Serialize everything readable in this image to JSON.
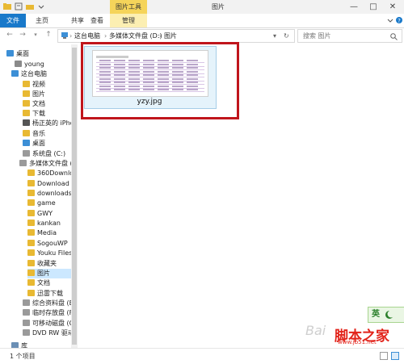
{
  "window": {
    "title": "图片",
    "tools_tab": "图片工具",
    "controls": [
      "—",
      "□",
      "✕"
    ]
  },
  "ribbon": {
    "tabs": [
      "文件",
      "主页",
      "共享",
      "查看",
      "管理"
    ]
  },
  "address": {
    "back": "←",
    "forward": "→",
    "up": "↑",
    "path": [
      "这台电脑",
      "多媒体文件盘 (D:)",
      "图片"
    ],
    "separator": "›",
    "dropdown": "▾",
    "refresh": "↻",
    "search_placeholder": "搜索 图片"
  },
  "nav": {
    "items": [
      {
        "label": "桌面",
        "icon": "desktop-icon"
      },
      {
        "label": "young",
        "icon": "user-icon"
      },
      {
        "label": "这台电脑",
        "icon": "computer-icon"
      },
      {
        "label": "视频",
        "icon": "video-folder-icon"
      },
      {
        "label": "图片",
        "icon": "pictures-folder-icon"
      },
      {
        "label": "文档",
        "icon": "documents-folder-icon"
      },
      {
        "label": "下载",
        "icon": "downloads-folder-icon"
      },
      {
        "label": "杨正英的 iPho",
        "icon": "phone-icon"
      },
      {
        "label": "音乐",
        "icon": "music-folder-icon"
      },
      {
        "label": "桌面",
        "icon": "desktop-icon"
      },
      {
        "label": "系统盘 (C:)",
        "icon": "drive-icon"
      },
      {
        "label": "多媒体文件盘 (D:",
        "icon": "drive-icon"
      },
      {
        "label": "360Downlo",
        "icon": "folder-icon"
      },
      {
        "label": "Download",
        "icon": "folder-icon"
      },
      {
        "label": "downloads",
        "icon": "folder-icon"
      },
      {
        "label": "game",
        "icon": "folder-icon"
      },
      {
        "label": "GWY",
        "icon": "folder-icon"
      },
      {
        "label": "kankan",
        "icon": "folder-icon"
      },
      {
        "label": "Media",
        "icon": "folder-icon"
      },
      {
        "label": "SogouWP",
        "icon": "folder-icon"
      },
      {
        "label": "Youku Files",
        "icon": "folder-icon"
      },
      {
        "label": "收藏夹",
        "icon": "folder-icon"
      },
      {
        "label": "图片",
        "icon": "folder-icon"
      },
      {
        "label": "文档",
        "icon": "folder-icon"
      },
      {
        "label": "迅雷下载",
        "icon": "folder-icon"
      },
      {
        "label": "综合资料盘 (E:",
        "icon": "drive-icon"
      },
      {
        "label": "临时存放盘 (F:",
        "icon": "drive-icon"
      },
      {
        "label": "可移动磁盘 (G:",
        "icon": "usb-drive-icon"
      },
      {
        "label": "DVD RW 驱动",
        "icon": "dvd-drive-icon"
      },
      {
        "label": "库",
        "icon": "library-icon"
      }
    ]
  },
  "content": {
    "file_name": "yzy.jpg"
  },
  "overlay": {
    "ime_label": "英",
    "watermark_baidu": "Bai",
    "watermark_site": "脚本之家",
    "watermark_url": "www.jb51.net"
  },
  "status": {
    "item_count": "1 个项目"
  },
  "colors": {
    "accent": "#1979ca",
    "tools_tab": "#f5d45a",
    "manage_tab": "#fcefb2",
    "selection": "#cce8ff",
    "highlight_box": "#c0151c"
  }
}
